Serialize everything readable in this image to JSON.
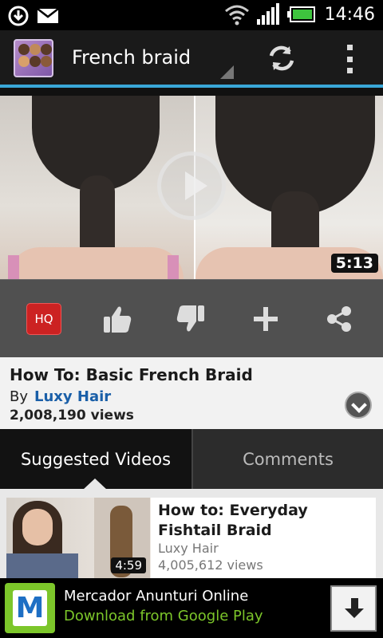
{
  "status_bar": {
    "time": "14:46",
    "icons": [
      "download-icon",
      "mail-icon",
      "wifi-icon",
      "signal-icon",
      "battery-icon"
    ]
  },
  "action_bar": {
    "title": "French braid",
    "app_icon": "hairstyle-app-icon",
    "refresh_icon": "refresh-icon",
    "overflow_icon": "overflow-menu-icon"
  },
  "video": {
    "duration": "5:13",
    "play_icon": "play-icon"
  },
  "controls": {
    "hq_label": "HQ",
    "icons": [
      "like-icon",
      "dislike-icon",
      "add-icon",
      "share-icon"
    ]
  },
  "info": {
    "title": "How To: Basic French Braid",
    "by_label": "By",
    "author": "Luxy Hair",
    "views": "2,008,190 views"
  },
  "tabs": [
    {
      "label": "Suggested Videos",
      "selected": true
    },
    {
      "label": "Comments",
      "selected": false
    }
  ],
  "suggested": [
    {
      "title": "How to: Everyday Fishtail Braid",
      "author": "Luxy Hair",
      "views": "4,005,612 views",
      "duration": "4:59"
    }
  ],
  "ad": {
    "title": "Mercador Anunturi Online",
    "subtitle": "Download from Google Play",
    "icon_letter": "M",
    "download_icon": "download-arrow-icon"
  },
  "colors": {
    "accent": "#3aa8d8",
    "hq_red": "#cc2222",
    "author_link": "#1a5fa8",
    "ad_green": "#7cc62a"
  }
}
